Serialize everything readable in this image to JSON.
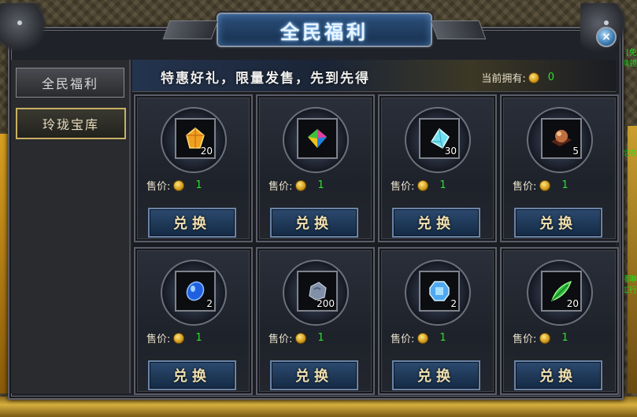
{
  "window": {
    "title": "全民福利",
    "close_label": "×"
  },
  "sidebar": {
    "tabs": [
      {
        "label": "全民福利"
      },
      {
        "label": "玲珑宝库"
      }
    ]
  },
  "banner": {
    "slogan": "特惠好礼，限量发售，先到先得",
    "owned_label": "当前拥有:",
    "owned_value": "0"
  },
  "background": {
    "side_text_right": [
      "[免",
      "换领",
      "龙衣",
      "猪琳",
      "工行"
    ]
  },
  "shop": {
    "price_label": "售价:",
    "exchange_label": "兑换",
    "items": [
      {
        "name": "orange-gem",
        "count": "20",
        "price": "1",
        "color": "#f0a020"
      },
      {
        "name": "rainbow-crystal",
        "count": "",
        "price": "1",
        "color": "#40c040"
      },
      {
        "name": "cyan-crystal",
        "count": "30",
        "price": "1",
        "color": "#70e0f0"
      },
      {
        "name": "bronze-orb",
        "count": "5",
        "price": "1",
        "color": "#c07040"
      },
      {
        "name": "blue-gem",
        "count": "2",
        "price": "1",
        "color": "#2060e0"
      },
      {
        "name": "gray-stone",
        "count": "200",
        "price": "1",
        "color": "#8090a8"
      },
      {
        "name": "blue-crystal",
        "count": "2",
        "price": "1",
        "color": "#50a8f0"
      },
      {
        "name": "green-leaf",
        "count": "20",
        "price": "1",
        "color": "#30c040"
      }
    ]
  }
}
